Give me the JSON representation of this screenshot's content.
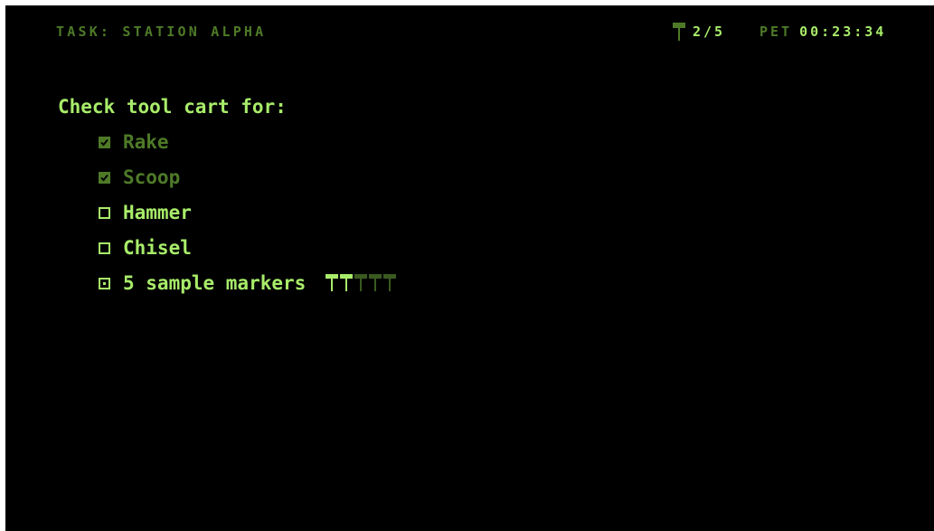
{
  "hud": {
    "task_label": "TASK: STATION ALPHA",
    "marker_counter": "2/5",
    "pet_label": "PET",
    "pet_time": "00:23:34"
  },
  "checklist": {
    "title": "Check tool cart for:",
    "items": [
      {
        "label": "Rake",
        "state": "checked"
      },
      {
        "label": "Scoop",
        "state": "checked"
      },
      {
        "label": "Hammer",
        "state": "unchecked"
      },
      {
        "label": "Chisel",
        "state": "unchecked"
      },
      {
        "label": "5 sample markers",
        "state": "partial",
        "collected": 2,
        "total": 5
      }
    ]
  },
  "icons": {
    "counter_icon": "sample-marker-icon",
    "progress_icon": "sample-marker-icon",
    "checked_box": "checkbox-checked-icon",
    "empty_box": "checkbox-empty-icon",
    "partial_box": "checkbox-partial-icon"
  },
  "colors": {
    "background": "#000000",
    "bright_green": "#a8ec6a",
    "dim_green": "#4e7a28",
    "empty_marker": "#3a5a1f"
  }
}
